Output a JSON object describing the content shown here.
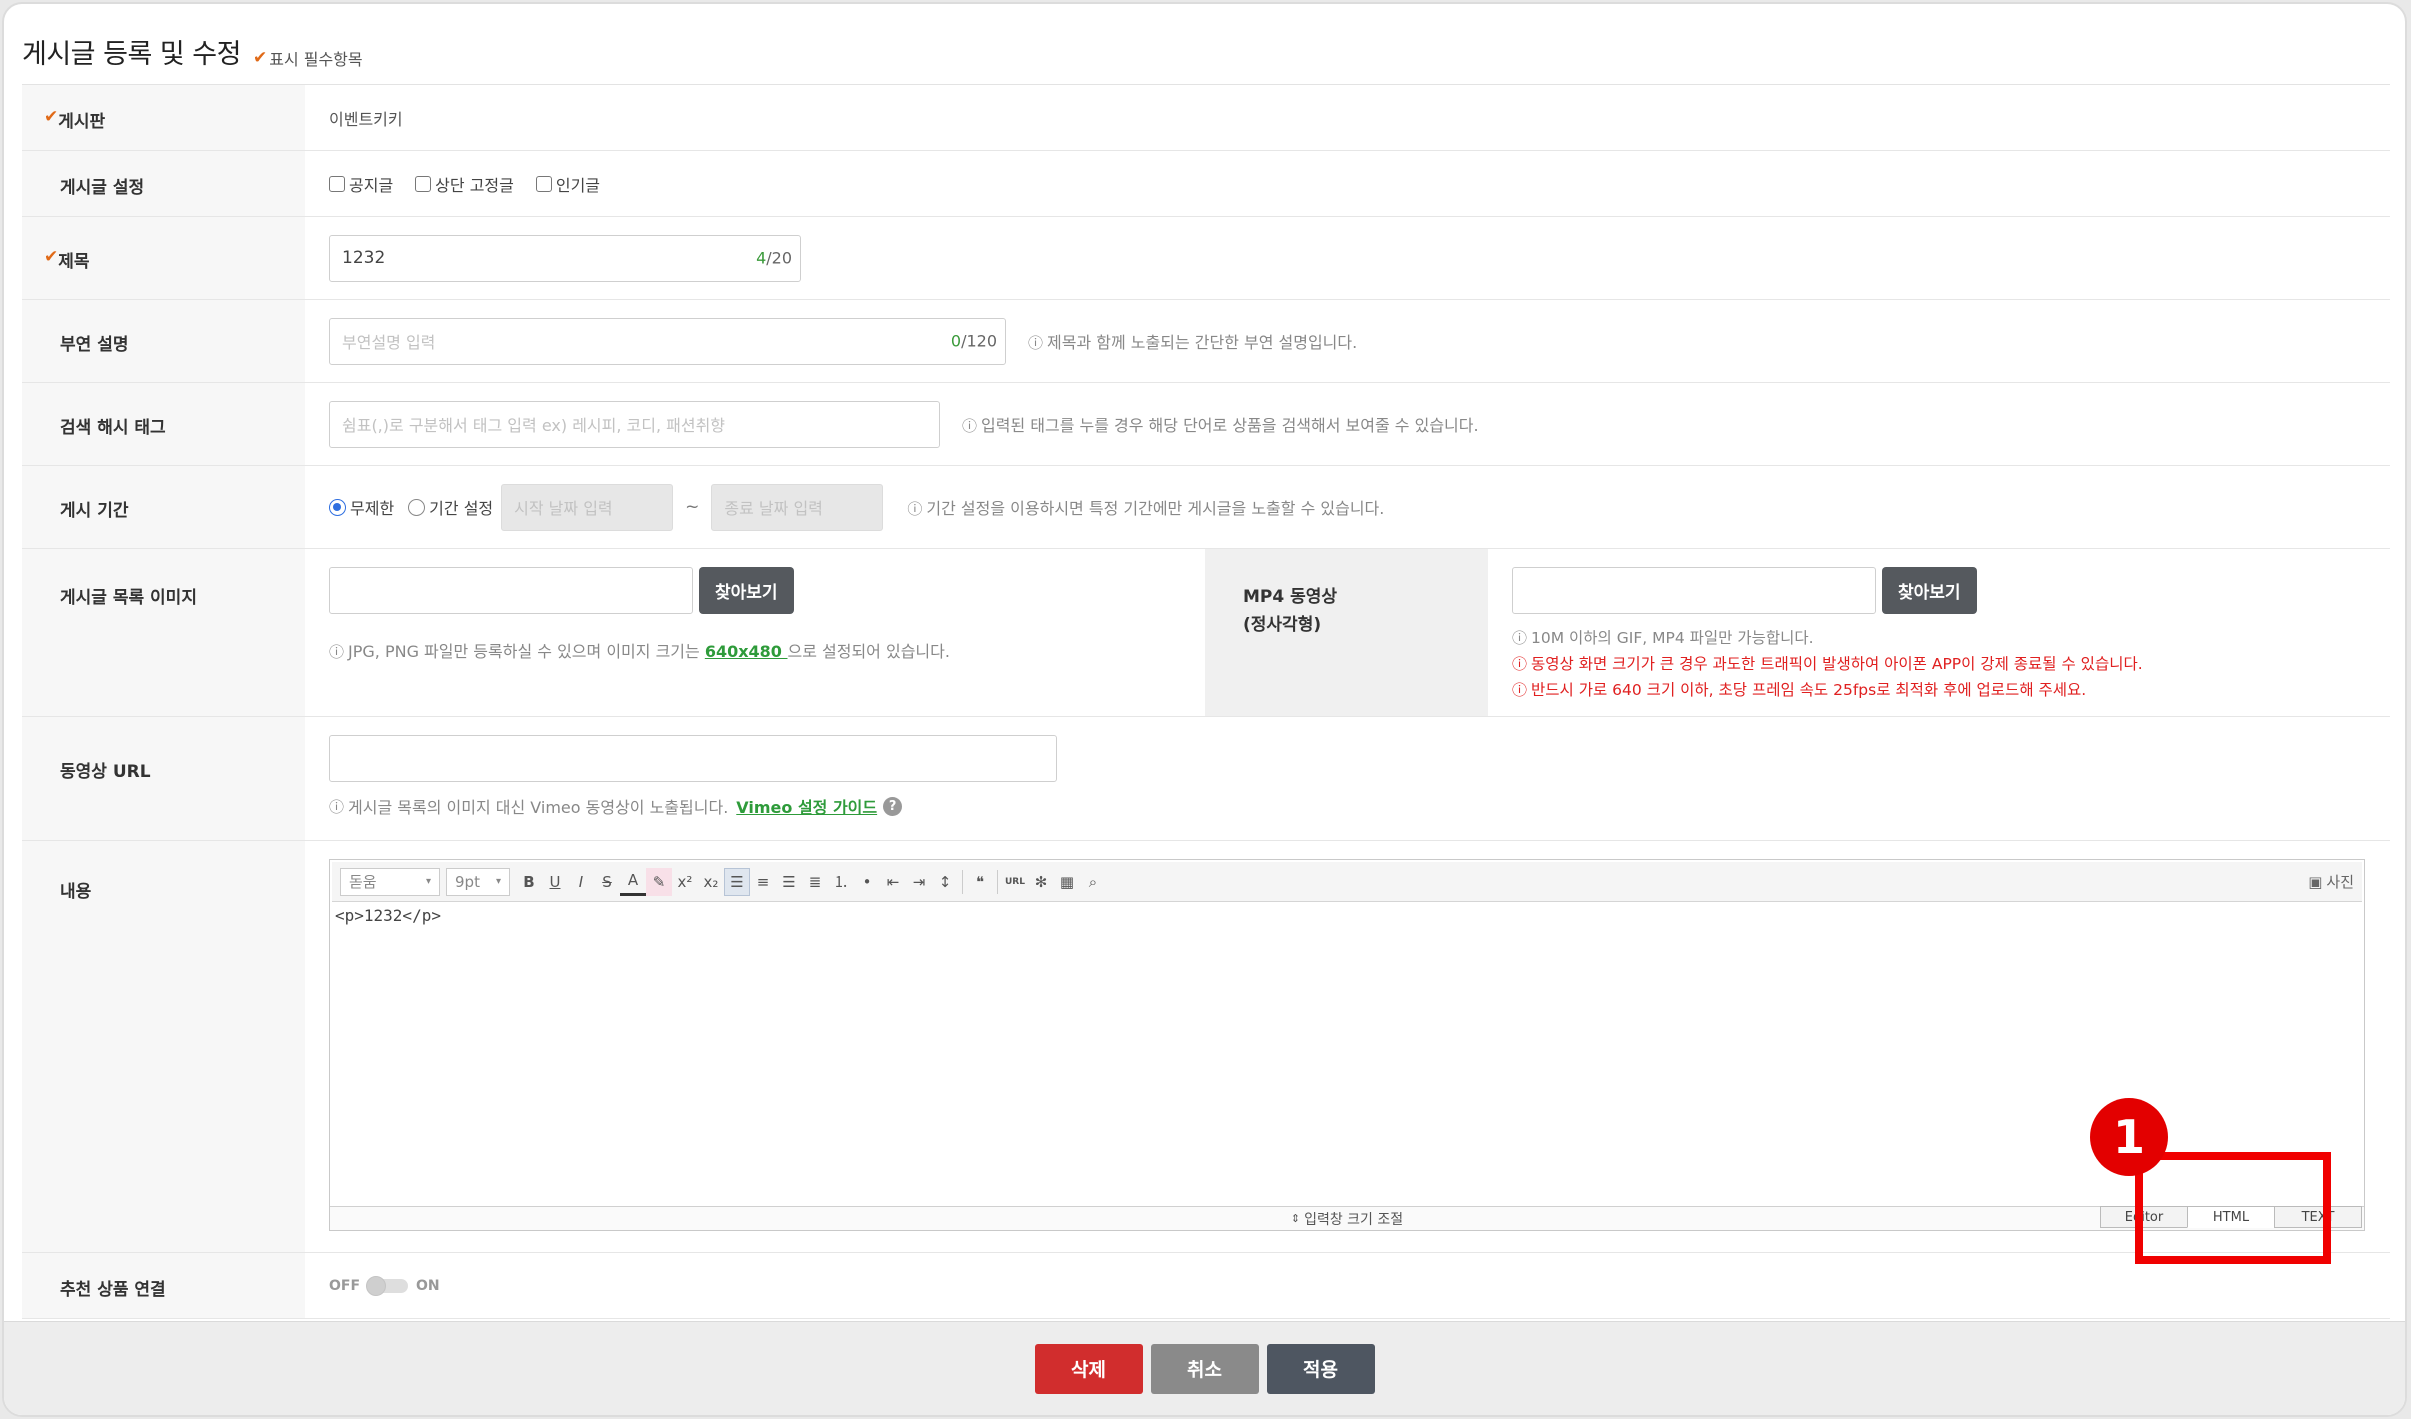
{
  "header": {
    "title": "게시글 등록 및 수정",
    "required_note": "표시 필수항목"
  },
  "board": {
    "label": "게시판",
    "value": "이벤트키키"
  },
  "post_settings": {
    "label": "게시글 설정",
    "options": [
      "공지글",
      "상단 고정글",
      "인기글"
    ]
  },
  "title_field": {
    "label": "제목",
    "value": "1232",
    "count": "4",
    "max": "/20"
  },
  "subtitle": {
    "label": "부연 설명",
    "placeholder": "부연설명 입력",
    "count": "0",
    "max": "/120",
    "hint": "제목과 함께 노출되는 간단한 부연 설명입니다."
  },
  "hashtag": {
    "label": "검색 해시 태그",
    "placeholder": "쉼표(,)로 구분해서 태그 입력 ex) 레시피, 코디, 패션취향",
    "hint": "입력된 태그를 누를 경우 해당 단어로 상품을 검색해서 보여줄 수 있습니다."
  },
  "period": {
    "label": "게시 기간",
    "option_unlimited": "무제한",
    "option_range": "기간 설정",
    "start_placeholder": "시작 날짜 입력",
    "tilde": "~",
    "end_placeholder": "종료 날짜 입력",
    "hint": "기간 설정을 이용하시면 특정 기간에만 게시글을 노출할 수 있습니다."
  },
  "list_image": {
    "label": "게시글 목록 이미지",
    "browse": "찾아보기",
    "hint_before": "JPG, PNG 파일만 등록하실 수 있으며 이미지 크기는 ",
    "size": "640x480 ",
    "hint_after": "으로 설정되어 있습니다."
  },
  "mp4": {
    "label_line1": "MP4 동영상",
    "label_line2": "(정사각형)",
    "browse": "찾아보기",
    "hint": "10M 이하의 GIF, MP4 파일만 가능합니다.",
    "warn1": "동영상 화면 크기가 큰 경우 과도한 트래픽이 발생하여 아이폰 APP이 강제 종료될 수 있습니다.",
    "warn2": "반드시 가로 640 크기 이하, 초당 프레임 속도 25fps로 최적화 후에 업로드해 주세요."
  },
  "video_url": {
    "label": "동영상 URL",
    "hint": "게시글 목록의 이미지 대신 Vimeo 동영상이 노출됩니다.",
    "guide": "Vimeo 설정 가이드"
  },
  "content": {
    "label": "내용",
    "font": "돋움",
    "size": "9pt",
    "photo": "사진",
    "body": "<p>1232</p>",
    "resize": "입력창 크기 조절",
    "tabs": [
      "Editor",
      "HTML",
      "TEXT"
    ],
    "active_tab": "HTML"
  },
  "recommend": {
    "label": "추천 상품 연결",
    "off": "OFF",
    "on": "ON"
  },
  "footer": {
    "delete": "삭제",
    "cancel": "취소",
    "apply": "적용"
  },
  "annotation": {
    "number": "1"
  },
  "colors": {
    "accent_check": "#e06a18",
    "link_green": "#2e9b3a",
    "warn_red": "#e02020",
    "annotation_red": "#f00000"
  }
}
